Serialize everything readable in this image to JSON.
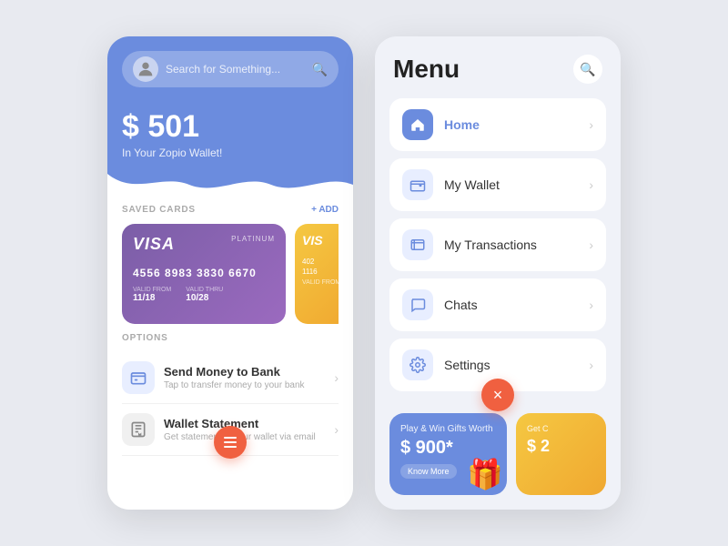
{
  "leftPanel": {
    "search": {
      "placeholder": "Search for Something..."
    },
    "balance": {
      "amount": "$ 501",
      "label": "In Your Zopio Wallet!"
    },
    "savedCards": {
      "title": "SAVED CARDS",
      "addLabel": "+ ADD",
      "cards": [
        {
          "type": "VISA",
          "tier": "PLATINUM",
          "number": "4556 8983 3830 6670",
          "validFrom": "11/18",
          "validThru": "10/28",
          "color": "purple"
        },
        {
          "type": "VISA",
          "number": "402",
          "extra": "1116",
          "color": "yellow"
        }
      ]
    },
    "options": {
      "title": "OPTIONS",
      "items": [
        {
          "title": "Send Money to Bank",
          "subtitle": "Tap to transfer money to your bank",
          "icon": "bank"
        },
        {
          "title": "Wallet Statement",
          "subtitle": "Get statement of your wallet via email",
          "icon": "statement"
        }
      ]
    },
    "hamburger": {
      "label": "menu"
    }
  },
  "rightPanel": {
    "title": "Menu",
    "menuItems": [
      {
        "label": "Home",
        "icon": "home",
        "active": true
      },
      {
        "label": "My Wallet",
        "icon": "wallet",
        "active": false
      },
      {
        "label": "My Transactions",
        "icon": "transactions",
        "active": false
      },
      {
        "label": "Chats",
        "icon": "chats",
        "active": false
      },
      {
        "label": "Settings",
        "icon": "settings",
        "active": false
      }
    ],
    "promos": [
      {
        "title": "Play & Win Gifts Worth",
        "amount": "$ 900*",
        "link": "Know More",
        "color": "blue"
      },
      {
        "title": "Get C",
        "amount": "$ 2",
        "color": "yellow"
      }
    ],
    "closeBtn": "×"
  }
}
